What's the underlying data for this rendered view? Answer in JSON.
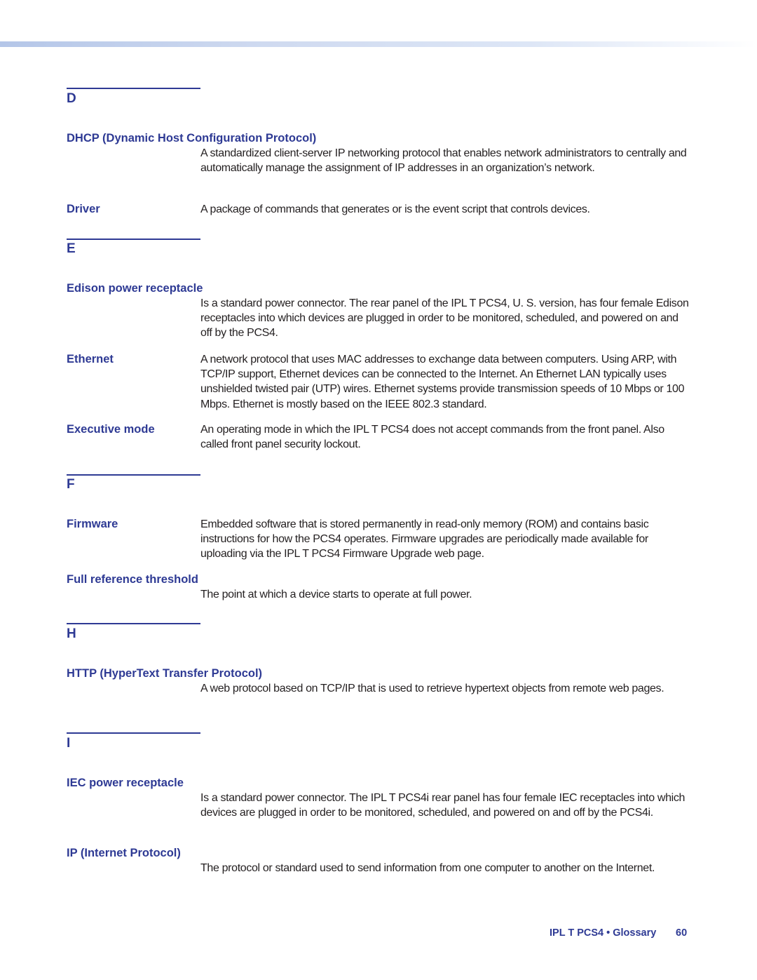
{
  "document": {
    "sections": [
      {
        "letter": "D",
        "entries": [
          {
            "term": "DHCP (Dynamic Host Configuration Protocol)",
            "definition": "A standardized client-server IP networking protocol that enables network administrators to centrally and automatically manage the assignment of IP addresses in an organization’s network."
          },
          {
            "term": "Driver",
            "definition": "A package of commands that generates or is the event script that controls devices."
          }
        ]
      },
      {
        "letter": "E",
        "entries": [
          {
            "term": "Edison power receptacle",
            "definition": "Is a standard power connector. The rear panel of the IPL T PCS4, U. S. version, has four female Edison receptacles into which devices are plugged in order to be monitored, scheduled, and powered on and off by the PCS4."
          },
          {
            "term": "Ethernet",
            "definition": "A network protocol that uses MAC addresses to exchange data between computers. Using ARP, with TCP/IP support, Ethernet devices can be connected to the Internet. An Ethernet LAN typically uses unshielded twisted pair (UTP) wires. Ethernet systems provide transmission speeds of 10 Mbps or 100 Mbps. Ethernet is mostly based on the IEEE 802.3 standard."
          },
          {
            "term": "Executive mode",
            "definition": "An operating mode in which the IPL T PCS4 does not accept commands from the front panel.  Also called front panel security lockout."
          }
        ]
      },
      {
        "letter": "F",
        "entries": [
          {
            "term": "Firmware",
            "definition": "Embedded software that is stored permanently in read-only memory (ROM) and contains basic instructions for how the PCS4 operates. Firmware upgrades are periodically made available for uploading via the IPL T PCS4 Firmware Upgrade web page."
          },
          {
            "term": "Full reference threshold",
            "definition": "The point at which a device starts to operate at full power."
          }
        ]
      },
      {
        "letter": "H",
        "entries": [
          {
            "term": "HTTP (HyperText Transfer Protocol)",
            "definition": "A web protocol based on TCP/IP that is used to retrieve hypertext objects from remote web pages."
          }
        ]
      },
      {
        "letter": "I",
        "entries": [
          {
            "term": "IEC power receptacle",
            "definition": "Is a standard power connector. The IPL T PCS4i rear panel has four female IEC receptacles into which devices are plugged in order to be monitored, scheduled, and powered on and off by the PCS4i."
          },
          {
            "term": "IP (Internet Protocol)",
            "definition": "The protocol or standard used to send information from one computer to another on the Internet."
          }
        ]
      }
    ],
    "footer": {
      "title": "IPL T PCS4 • Glossary",
      "page_number": "60"
    }
  }
}
